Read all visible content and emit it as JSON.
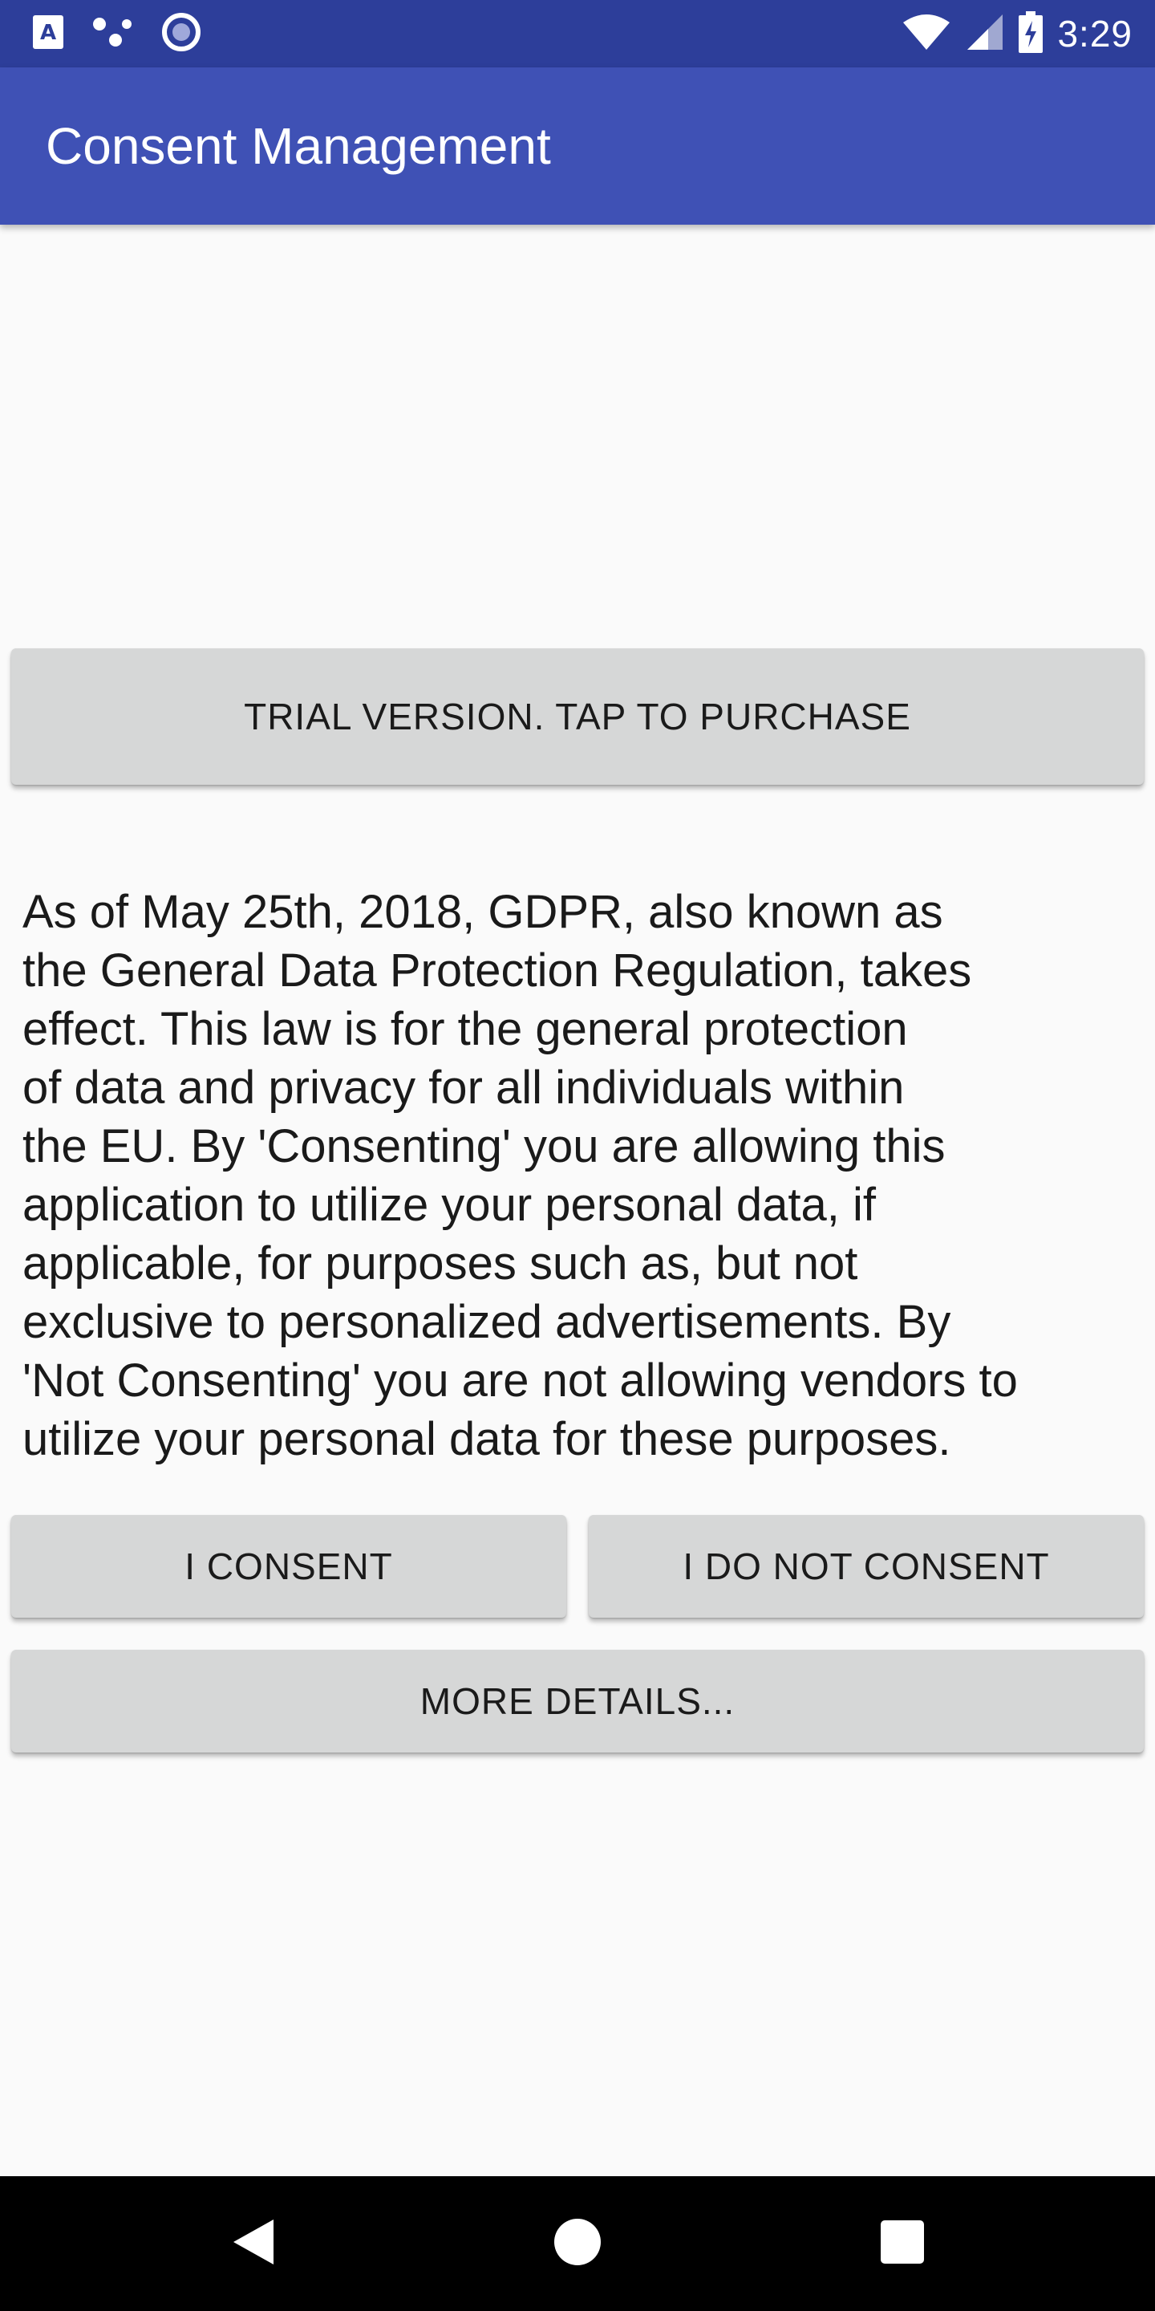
{
  "status_bar": {
    "time": "3:29",
    "left_icons": [
      "font-a-icon",
      "dots-icon",
      "circle-record-icon"
    ],
    "right_icons": [
      "wifi-icon",
      "cell-signal-icon",
      "battery-charging-icon"
    ]
  },
  "app_bar": {
    "title": "Consent Management",
    "color": "#3f51b5"
  },
  "buttons": {
    "trial": "TRIAL VERSION. TAP TO PURCHASE",
    "consent": "I CONSENT",
    "no_consent": "I DO NOT CONSENT",
    "more_details": "MORE DETAILS..."
  },
  "body": {
    "gdpr_text": "As of May 25th, 2018, GDPR, also known as\nthe General Data Protection Regulation, takes\neffect. This law is for the general protection\nof data and privacy for all individuals within\nthe EU. By 'Consenting' you are allowing this\napplication to utilize your personal data, if\napplicable, for purposes such as, but not\nexclusive to personalized advertisements. By\n'Not Consenting' you are not allowing vendors to\nutilize your personal data for these purposes."
  },
  "nav_bar": {
    "items": [
      "back-icon",
      "home-icon",
      "recents-icon"
    ]
  }
}
